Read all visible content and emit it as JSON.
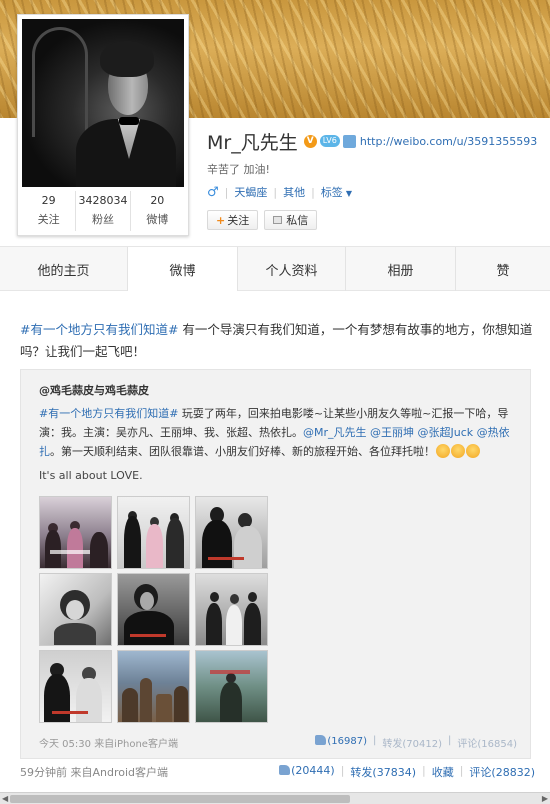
{
  "profile": {
    "name": "Mr_凡先生",
    "verified_badge": "V",
    "level_badge": "LV6",
    "homepage_url": "http://weibo.com/u/3591355593",
    "bio": "辛苦了 加油!",
    "gender_icon": "male-icon",
    "location": "天蝎座",
    "other_label": "其他",
    "tags_label": "标签",
    "follow_label": "关注",
    "message_label": "私信",
    "stats": [
      {
        "num": "29",
        "label": "关注"
      },
      {
        "num": "3428034",
        "label": "粉丝"
      },
      {
        "num": "20",
        "label": "微博"
      }
    ]
  },
  "tabs": [
    "他的主页",
    "微博",
    "个人资料",
    "相册",
    "赞"
  ],
  "active_tab": "微博",
  "post": {
    "topic": "#有一个地方只有我们知道#",
    "text": " 有一个导演只有我们知道，一个有梦想有故事的地方，你想知道吗？让我们一起飞吧！",
    "repost": {
      "author": "@鸡毛蒜皮与鸡毛蒜皮",
      "topic": "#有一个地方只有我们知道#",
      "text1": " 玩耍了两年，回来拍电影喽~让某些小朋友久等啦~汇报一下哈，导演：我。主演：吴亦凡、王丽坤、我、张超、热依扎。",
      "mention1": "@Mr_凡先生",
      "mention2": "@王丽坤",
      "mention3": "@张超Juck",
      "mention4": "@热依扎",
      "text2": "。第一天顺利结束、团队很靠谱、小朋友们好棒、新的旅程开始、各位拜托啦！",
      "english": "It's all about LOVE.",
      "time": "今天 05:30",
      "source": "来自iPhone客户端",
      "likes": "(16987)",
      "forward": "转发(70412)",
      "comment": "评论(16854)"
    },
    "time": "59分钟前",
    "source": "来自Android客户端",
    "likes": "(20444)",
    "forward": "转发(37834)",
    "favorite": "收藏",
    "comment": "评论(28832)"
  },
  "colors": {
    "link": "#2f6eb3",
    "accent": "#f08a1c",
    "cover": "#d4a24a"
  }
}
